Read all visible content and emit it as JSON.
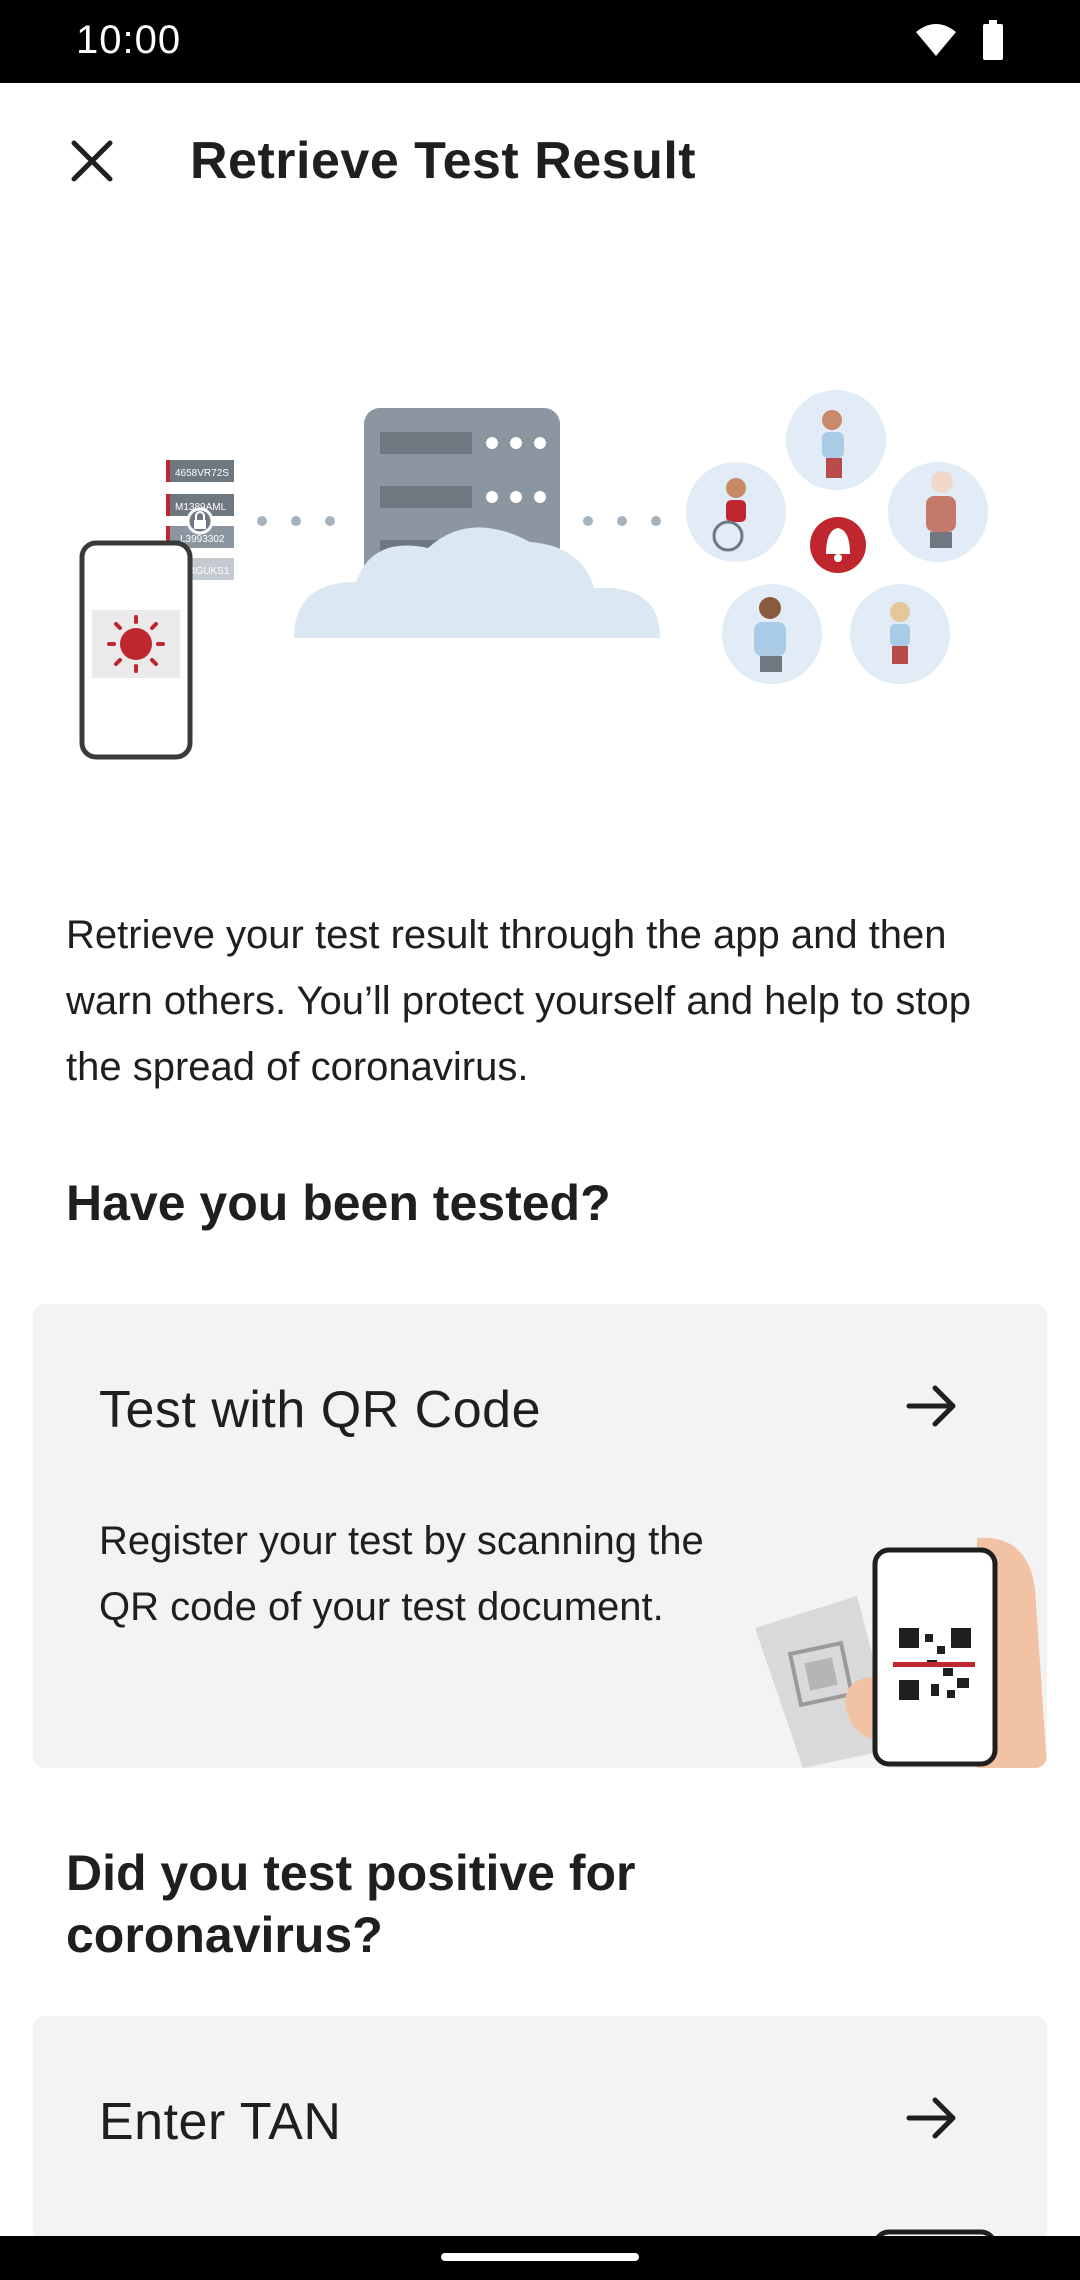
{
  "status_bar": {
    "time": "10:00",
    "icons": [
      "wifi-icon",
      "battery-icon"
    ]
  },
  "app_bar": {
    "title": "Retrieve Test Result",
    "close_icon": "close-icon"
  },
  "hero": {
    "code_strips": [
      "4658VR72S",
      "M1389AML",
      "L3993302",
      "4GUKS1"
    ]
  },
  "intro": {
    "text": "Retrieve your test result through the app and then warn others. You’ll protect yourself and help to stop the spread of coronavirus."
  },
  "sections": [
    {
      "title": "Have you been tested?",
      "card": {
        "title": "Test with QR Code",
        "description": "Register your test by scanning the QR code of your test document.",
        "arrow_icon": "arrow-right-icon"
      }
    },
    {
      "title": "Did you test positive for coronavirus?",
      "card": {
        "title": "Enter TAN",
        "arrow_icon": "arrow-right-icon"
      }
    }
  ],
  "colors": {
    "card_bg": "#f3f3f3",
    "accent_red": "#c0262d",
    "server_gray": "#8b96a0",
    "cloud_blue": "#dbe7f2"
  }
}
